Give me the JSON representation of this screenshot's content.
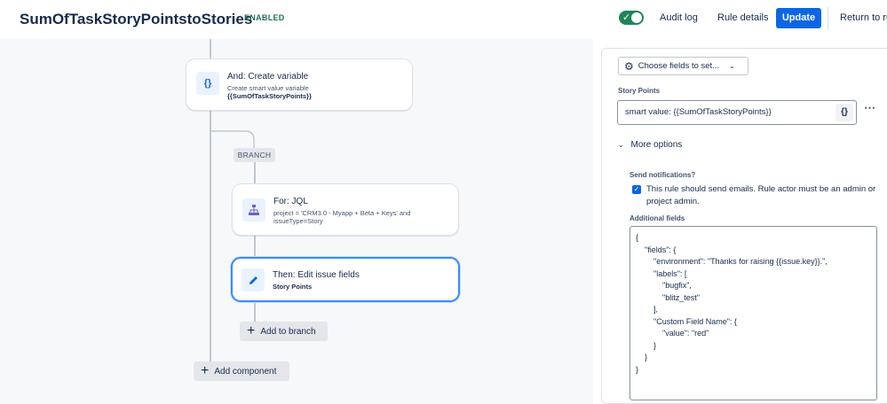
{
  "header": {
    "title": "SumOfTaskStoryPointstoStories",
    "status": "ENABLED",
    "toggle_on": true,
    "audit_log": "Audit log",
    "rule_details": "Rule details",
    "update": "Update",
    "return": "Return to ru"
  },
  "flow": {
    "create_variable": {
      "title": "And: Create variable",
      "desc": "Create smart value variable",
      "var": "{{SumOfTaskStoryPoints}}",
      "icon": "curly-braces-icon"
    },
    "branch_label": "BRANCH",
    "for_jql": {
      "title": "For: JQL",
      "desc_line1": "project = 'CRM3.0 - Myapp + Beta + Keys' and",
      "desc_line2": "issueType=Story",
      "icon": "hierarchy-icon"
    },
    "edit_fields": {
      "title": "Then: Edit issue fields",
      "field": "Story Points",
      "icon": "pencil-icon"
    },
    "add_to_branch": "Add to branch",
    "add_component": "Add component"
  },
  "panel": {
    "choose_fields": "Choose fields to set...",
    "story_points_label": "Story Points",
    "story_points_value": "smart value: {{SumOfTaskStoryPoints}}",
    "curly_label": "{}",
    "more_options": "More options",
    "send_notifications_label": "Send notifications?",
    "notify_text": "This rule should send emails. Rule actor must be an admin or project admin.",
    "notify_checked": true,
    "additional_fields_label": "Additional fields",
    "additional_fields_json": "{\n    \"fields\": {\n        \"environment\": \"Thanks for raising {{issue.key}}.\",\n        \"labels\": [\n            \"bugfix\",\n            \"blitz_test\"\n        ],\n        \"Custom Field Name\": {\n            \"value\": \"red\"\n        }\n    }\n}"
  },
  "colors": {
    "accent": "#0c66e4",
    "enabled_green": "#216e4e",
    "toggle_green": "#1f845a",
    "selected_border": "#388bff"
  }
}
